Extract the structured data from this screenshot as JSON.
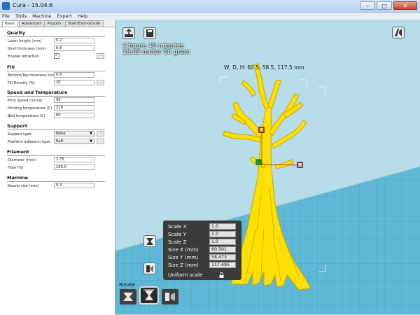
{
  "window": {
    "title": "Cura - 15.04.6"
  },
  "menu": [
    "File",
    "Tools",
    "Machine",
    "Expert",
    "Help"
  ],
  "tabs": [
    "Basic",
    "Advanced",
    "Plugins",
    "Start/End-GCode"
  ],
  "sections": {
    "quality": {
      "title": "Quality",
      "layer_height": {
        "label": "Layer height (mm)",
        "value": "0.2"
      },
      "shell_thickness": {
        "label": "Shell thickness (mm)",
        "value": "0.8"
      },
      "retraction": {
        "label": "Enable retraction",
        "checked": "✓",
        "more": "..."
      }
    },
    "fill": {
      "title": "Fill",
      "bottom_top": {
        "label": "Bottom/Top thickness (mm)",
        "value": "0.8"
      },
      "density": {
        "label": "Fill Density (%)",
        "value": "20",
        "more": "..."
      }
    },
    "speed": {
      "title": "Speed and Temperature",
      "print_speed": {
        "label": "Print speed (mm/s)",
        "value": "90"
      },
      "print_temp": {
        "label": "Printing temperature (C)",
        "value": "210"
      },
      "bed_temp": {
        "label": "Bed temperature (C)",
        "value": "60"
      }
    },
    "support": {
      "title": "Support",
      "type": {
        "label": "Support type",
        "value": "None",
        "more": "..."
      },
      "adhesion": {
        "label": "Platform adhesion type",
        "value": "Raft",
        "more": "..."
      }
    },
    "filament": {
      "title": "Filament",
      "diameter": {
        "label": "Diameter (mm)",
        "value": "1.75"
      },
      "flow": {
        "label": "Flow (%)",
        "value": "100.0"
      }
    },
    "machine": {
      "title": "Machine",
      "nozzle": {
        "label": "Nozzle size (mm)",
        "value": "0.4"
      }
    }
  },
  "viewport": {
    "print_time": "4 hours 43 minutes",
    "material": "18.02 meter 50 gram",
    "dimensions": "W, D, H: 60.5, 58.5, 117.5 mm",
    "scale": {
      "x": {
        "label": "Scale X",
        "value": "1.0"
      },
      "y": {
        "label": "Scale Y",
        "value": "1.0"
      },
      "z": {
        "label": "Scale Z",
        "value": "1.0"
      },
      "size_x": {
        "label": "Size X (mm)",
        "value": "60.501"
      },
      "size_y": {
        "label": "Size Y (mm)",
        "value": "58.473"
      },
      "size_z": {
        "label": "Size Z (mm)",
        "value": "117.495"
      },
      "uniform": {
        "label": "Uniform scale"
      }
    },
    "rotate_label": "Rotate"
  },
  "colors": {
    "model": "#ffe000",
    "bed": "#5fb9d6",
    "panel": "#3b3b3b"
  }
}
